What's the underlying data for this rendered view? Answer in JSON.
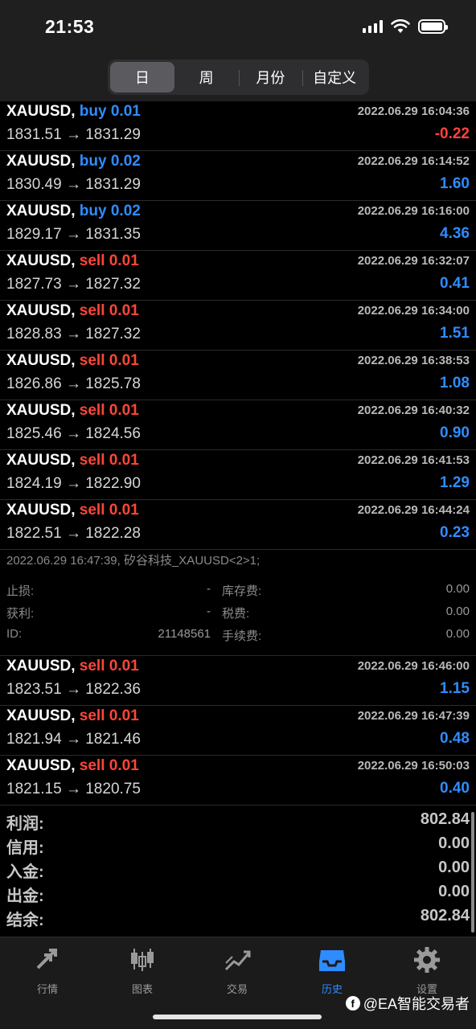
{
  "status": {
    "time": "21:53"
  },
  "period_tabs": [
    {
      "label": "日",
      "active": true
    },
    {
      "label": "周",
      "active": false
    },
    {
      "label": "月份",
      "active": false
    },
    {
      "label": "自定义",
      "active": false
    }
  ],
  "deals_top": [
    {
      "symbol": "XAUUSD,",
      "side": "buy",
      "volume": "0.01",
      "time": "2022.06.29 16:04:36",
      "prices": "1831.51 → 1831.29",
      "profit": "-0.22"
    },
    {
      "symbol": "XAUUSD,",
      "side": "buy",
      "volume": "0.02",
      "time": "2022.06.29 16:14:52",
      "prices": "1830.49 → 1831.29",
      "profit": "1.60"
    },
    {
      "symbol": "XAUUSD,",
      "side": "buy",
      "volume": "0.02",
      "time": "2022.06.29 16:16:00",
      "prices": "1829.17 → 1831.35",
      "profit": "4.36"
    },
    {
      "symbol": "XAUUSD,",
      "side": "sell",
      "volume": "0.01",
      "time": "2022.06.29 16:32:07",
      "prices": "1827.73 → 1827.32",
      "profit": "0.41"
    },
    {
      "symbol": "XAUUSD,",
      "side": "sell",
      "volume": "0.01",
      "time": "2022.06.29 16:34:00",
      "prices": "1828.83 → 1827.32",
      "profit": "1.51"
    },
    {
      "symbol": "XAUUSD,",
      "side": "sell",
      "volume": "0.01",
      "time": "2022.06.29 16:38:53",
      "prices": "1826.86 → 1825.78",
      "profit": "1.08"
    },
    {
      "symbol": "XAUUSD,",
      "side": "sell",
      "volume": "0.01",
      "time": "2022.06.29 16:40:32",
      "prices": "1825.46 → 1824.56",
      "profit": "0.90"
    },
    {
      "symbol": "XAUUSD,",
      "side": "sell",
      "volume": "0.01",
      "time": "2022.06.29 16:41:53",
      "prices": "1824.19 → 1822.90",
      "profit": "1.29"
    },
    {
      "symbol": "XAUUSD,",
      "side": "sell",
      "volume": "0.01",
      "time": "2022.06.29 16:44:24",
      "prices": "1822.51 → 1822.28",
      "profit": "0.23"
    }
  ],
  "details": {
    "comment": "2022.06.29 16:47:39, 矽谷科技_XAUUSD<2>1;",
    "sl_label": "止损:",
    "sl_value": "-",
    "swap_label": "库存费:",
    "swap_value": "0.00",
    "tp_label": "获利:",
    "tp_value": "-",
    "tax_label": "税费:",
    "tax_value": "0.00",
    "id_label": "ID:",
    "id_value": "21148561",
    "fee_label": "手续费:",
    "fee_value": "0.00"
  },
  "deals_bottom": [
    {
      "symbol": "XAUUSD,",
      "side": "sell",
      "volume": "0.01",
      "time": "2022.06.29 16:46:00",
      "prices": "1823.51 → 1822.36",
      "profit": "1.15"
    },
    {
      "symbol": "XAUUSD,",
      "side": "sell",
      "volume": "0.01",
      "time": "2022.06.29 16:47:39",
      "prices": "1821.94 → 1821.46",
      "profit": "0.48"
    },
    {
      "symbol": "XAUUSD,",
      "side": "sell",
      "volume": "0.01",
      "time": "2022.06.29 16:50:03",
      "prices": "1821.15 → 1820.75",
      "profit": "0.40"
    }
  ],
  "summary": [
    {
      "label": "利润:",
      "value": "802.84"
    },
    {
      "label": "信用:",
      "value": "0.00"
    },
    {
      "label": "入金:",
      "value": "0.00"
    },
    {
      "label": "出金:",
      "value": "0.00"
    },
    {
      "label": "结余:",
      "value": "802.84"
    }
  ],
  "tabbar": [
    {
      "label": "行情",
      "icon": "quotes-arrows-icon",
      "active": false
    },
    {
      "label": "图表",
      "icon": "candlestick-chart-icon",
      "active": false
    },
    {
      "label": "交易",
      "icon": "trade-trend-icon",
      "active": false
    },
    {
      "label": "历史",
      "icon": "history-inbox-icon",
      "active": true
    },
    {
      "label": "设置",
      "icon": "gear-icon",
      "active": false
    }
  ],
  "watermark": {
    "text": "@EA智能交易者"
  },
  "colors": {
    "buy": "#2f8cff",
    "sell": "#ff453a",
    "profit_positive": "#2f8cff",
    "profit_negative": "#ff453a",
    "active_tab": "#2f8cff"
  }
}
